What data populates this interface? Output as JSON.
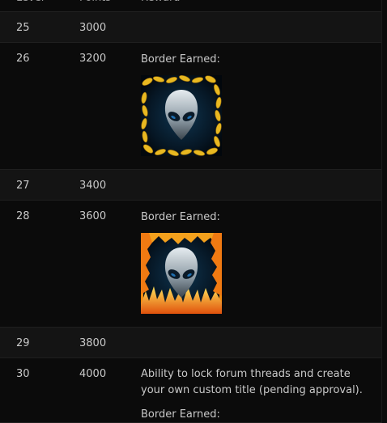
{
  "header": {
    "level": "Level",
    "points": "Points",
    "reward": "Reward"
  },
  "rows": [
    {
      "level": "25",
      "points": "3000",
      "reward": ""
    },
    {
      "level": "26",
      "points": "3200",
      "reward": "Border Earned:",
      "badge": "gold-laurel-border"
    },
    {
      "level": "27",
      "points": "3400",
      "reward": ""
    },
    {
      "level": "28",
      "points": "3600",
      "reward": "Border Earned:",
      "badge": "fire-border"
    },
    {
      "level": "29",
      "points": "3800",
      "reward": ""
    },
    {
      "level": "30",
      "points": "4000",
      "reward": "Ability to lock forum threads and create your own custom title (pending approval).",
      "reward_sub": "Border Earned:"
    }
  ]
}
